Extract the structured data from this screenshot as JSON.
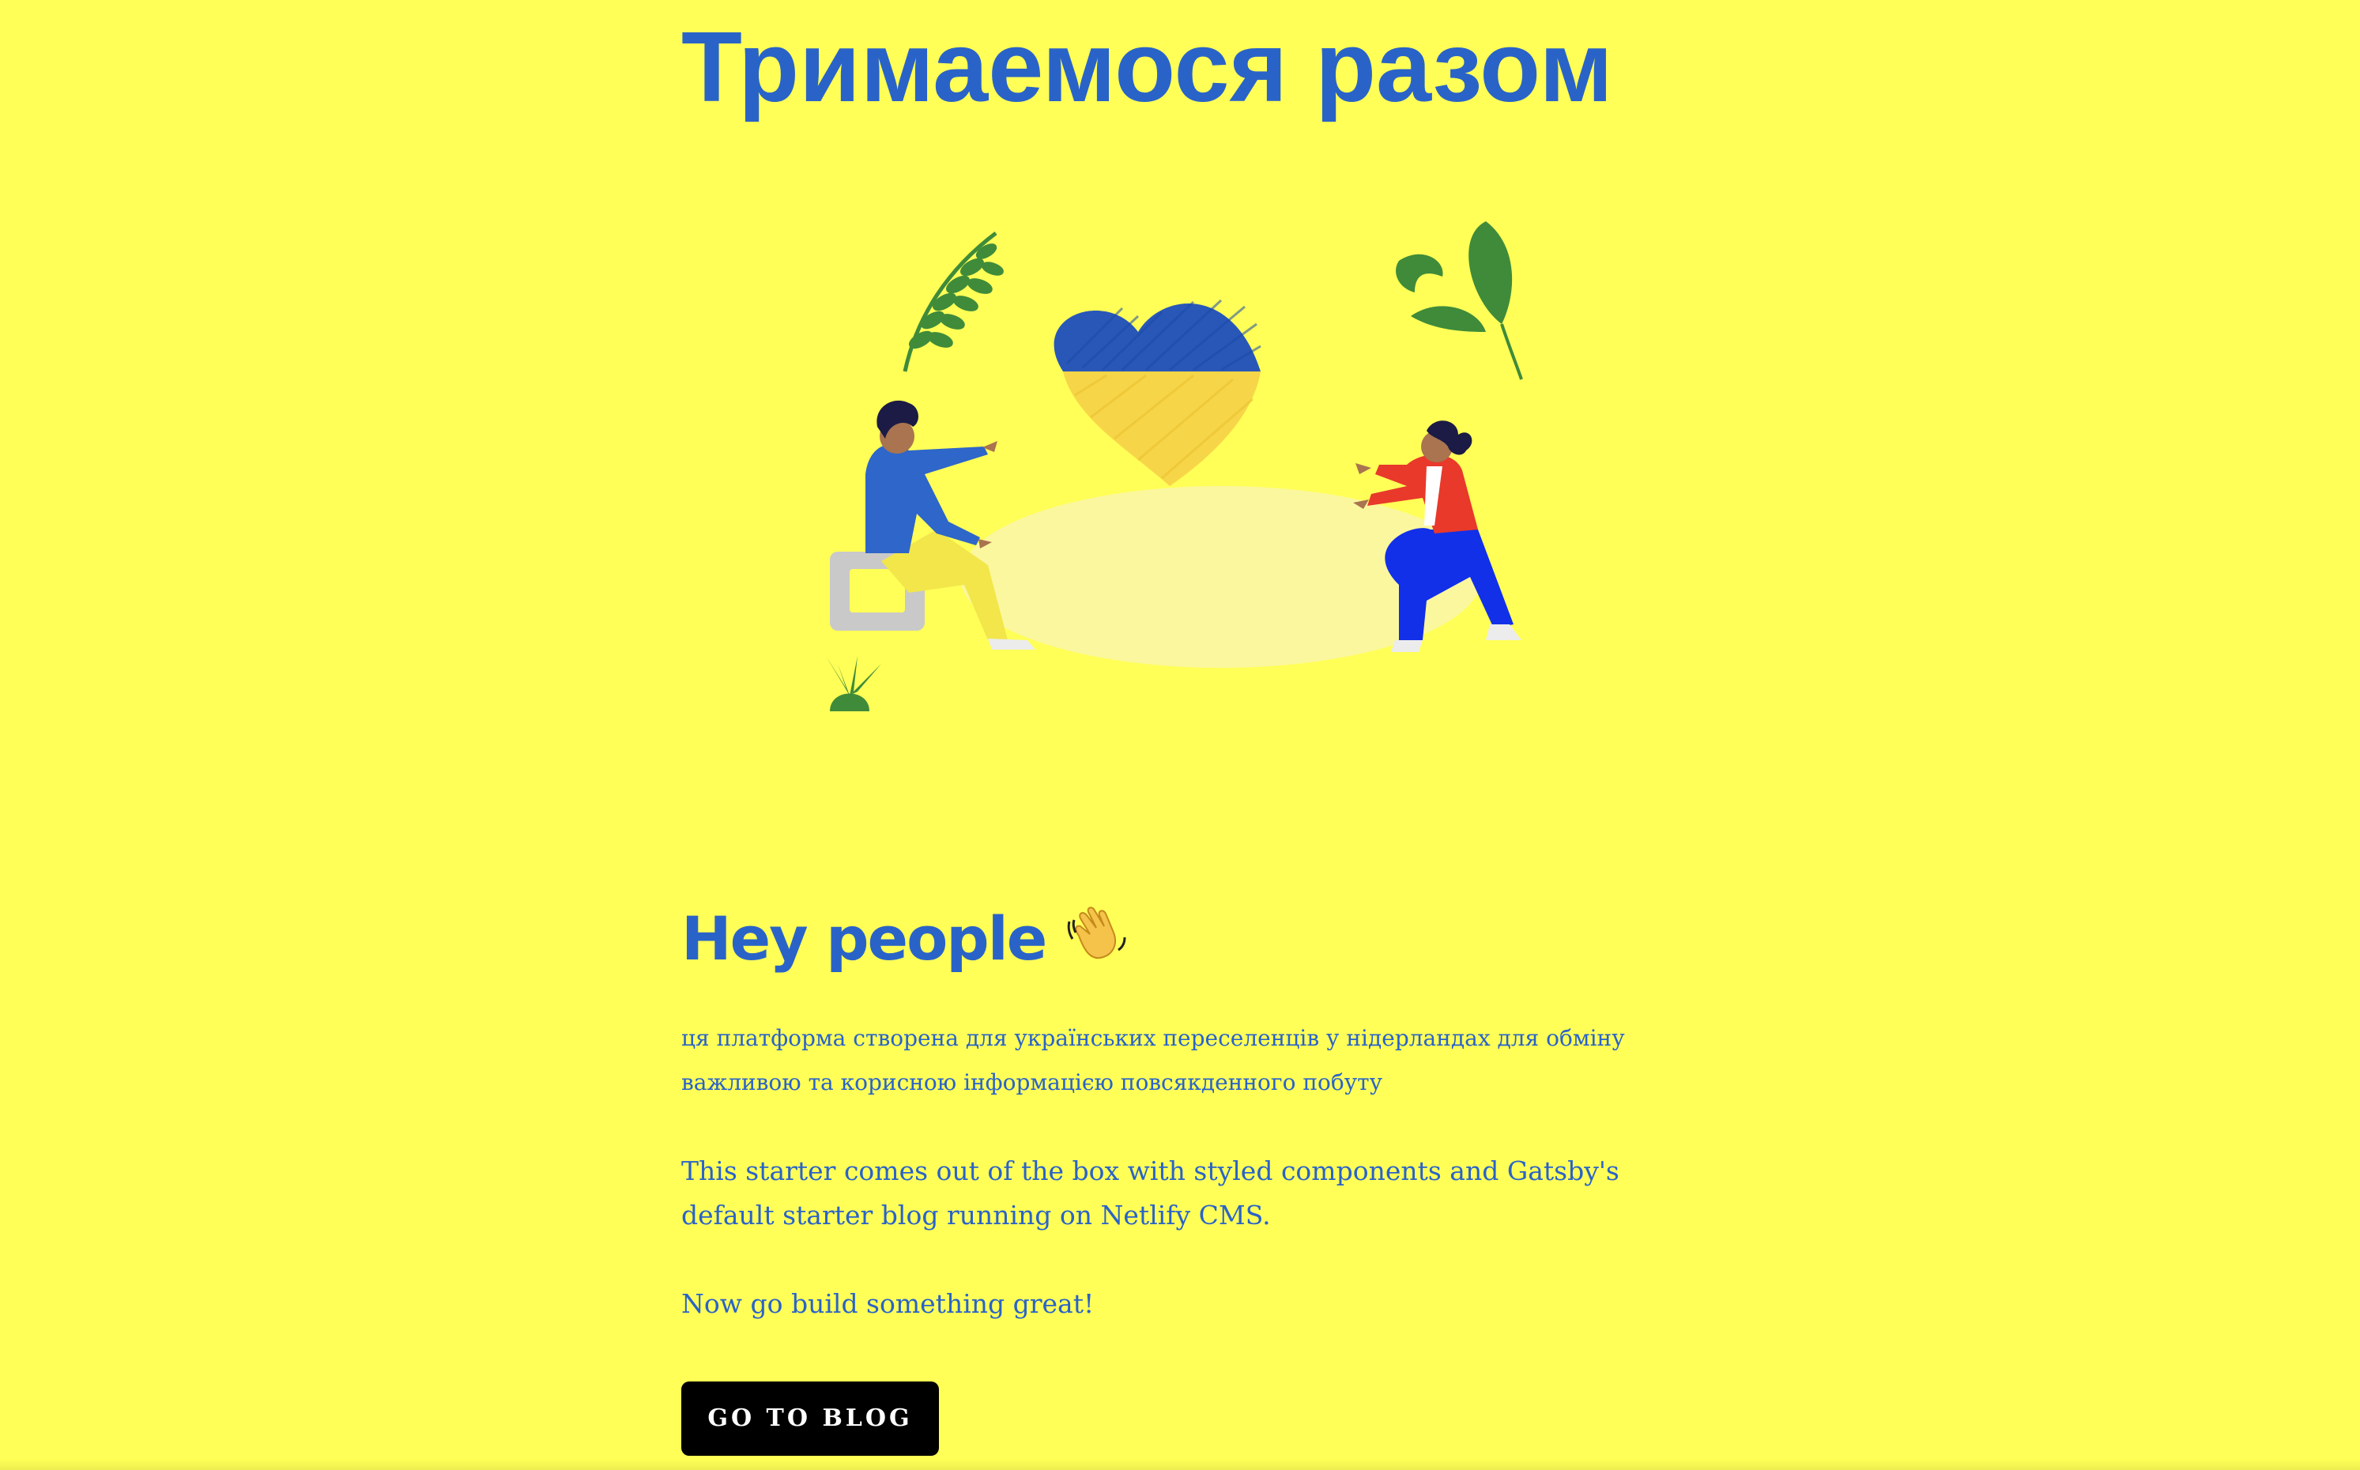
{
  "header": {
    "title": "Тримаемося разом"
  },
  "hero": {
    "illustration": "two-people-ukrainian-heart-illustration"
  },
  "intro": {
    "heading": "Hey people",
    "heading_emoji": "waving-hand-icon",
    "paragraph_uk": "ця платформа створена для українських переселенців у нідерландах для обміну важливою та корисною інформацією повсякденного побуту",
    "paragraph_en": "This starter comes out of the box with styled components and Gatsby's default starter blog running on Netlify CMS.",
    "paragraph_cta": "Now go build something great!"
  },
  "actions": {
    "blog_button_label": "GO TO BLOG"
  },
  "colors": {
    "background": "#ffff57",
    "accent_blue": "#2a63c8",
    "button_bg": "#000000",
    "flag_blue": "#2857b8",
    "flag_yellow": "#f7d548"
  }
}
